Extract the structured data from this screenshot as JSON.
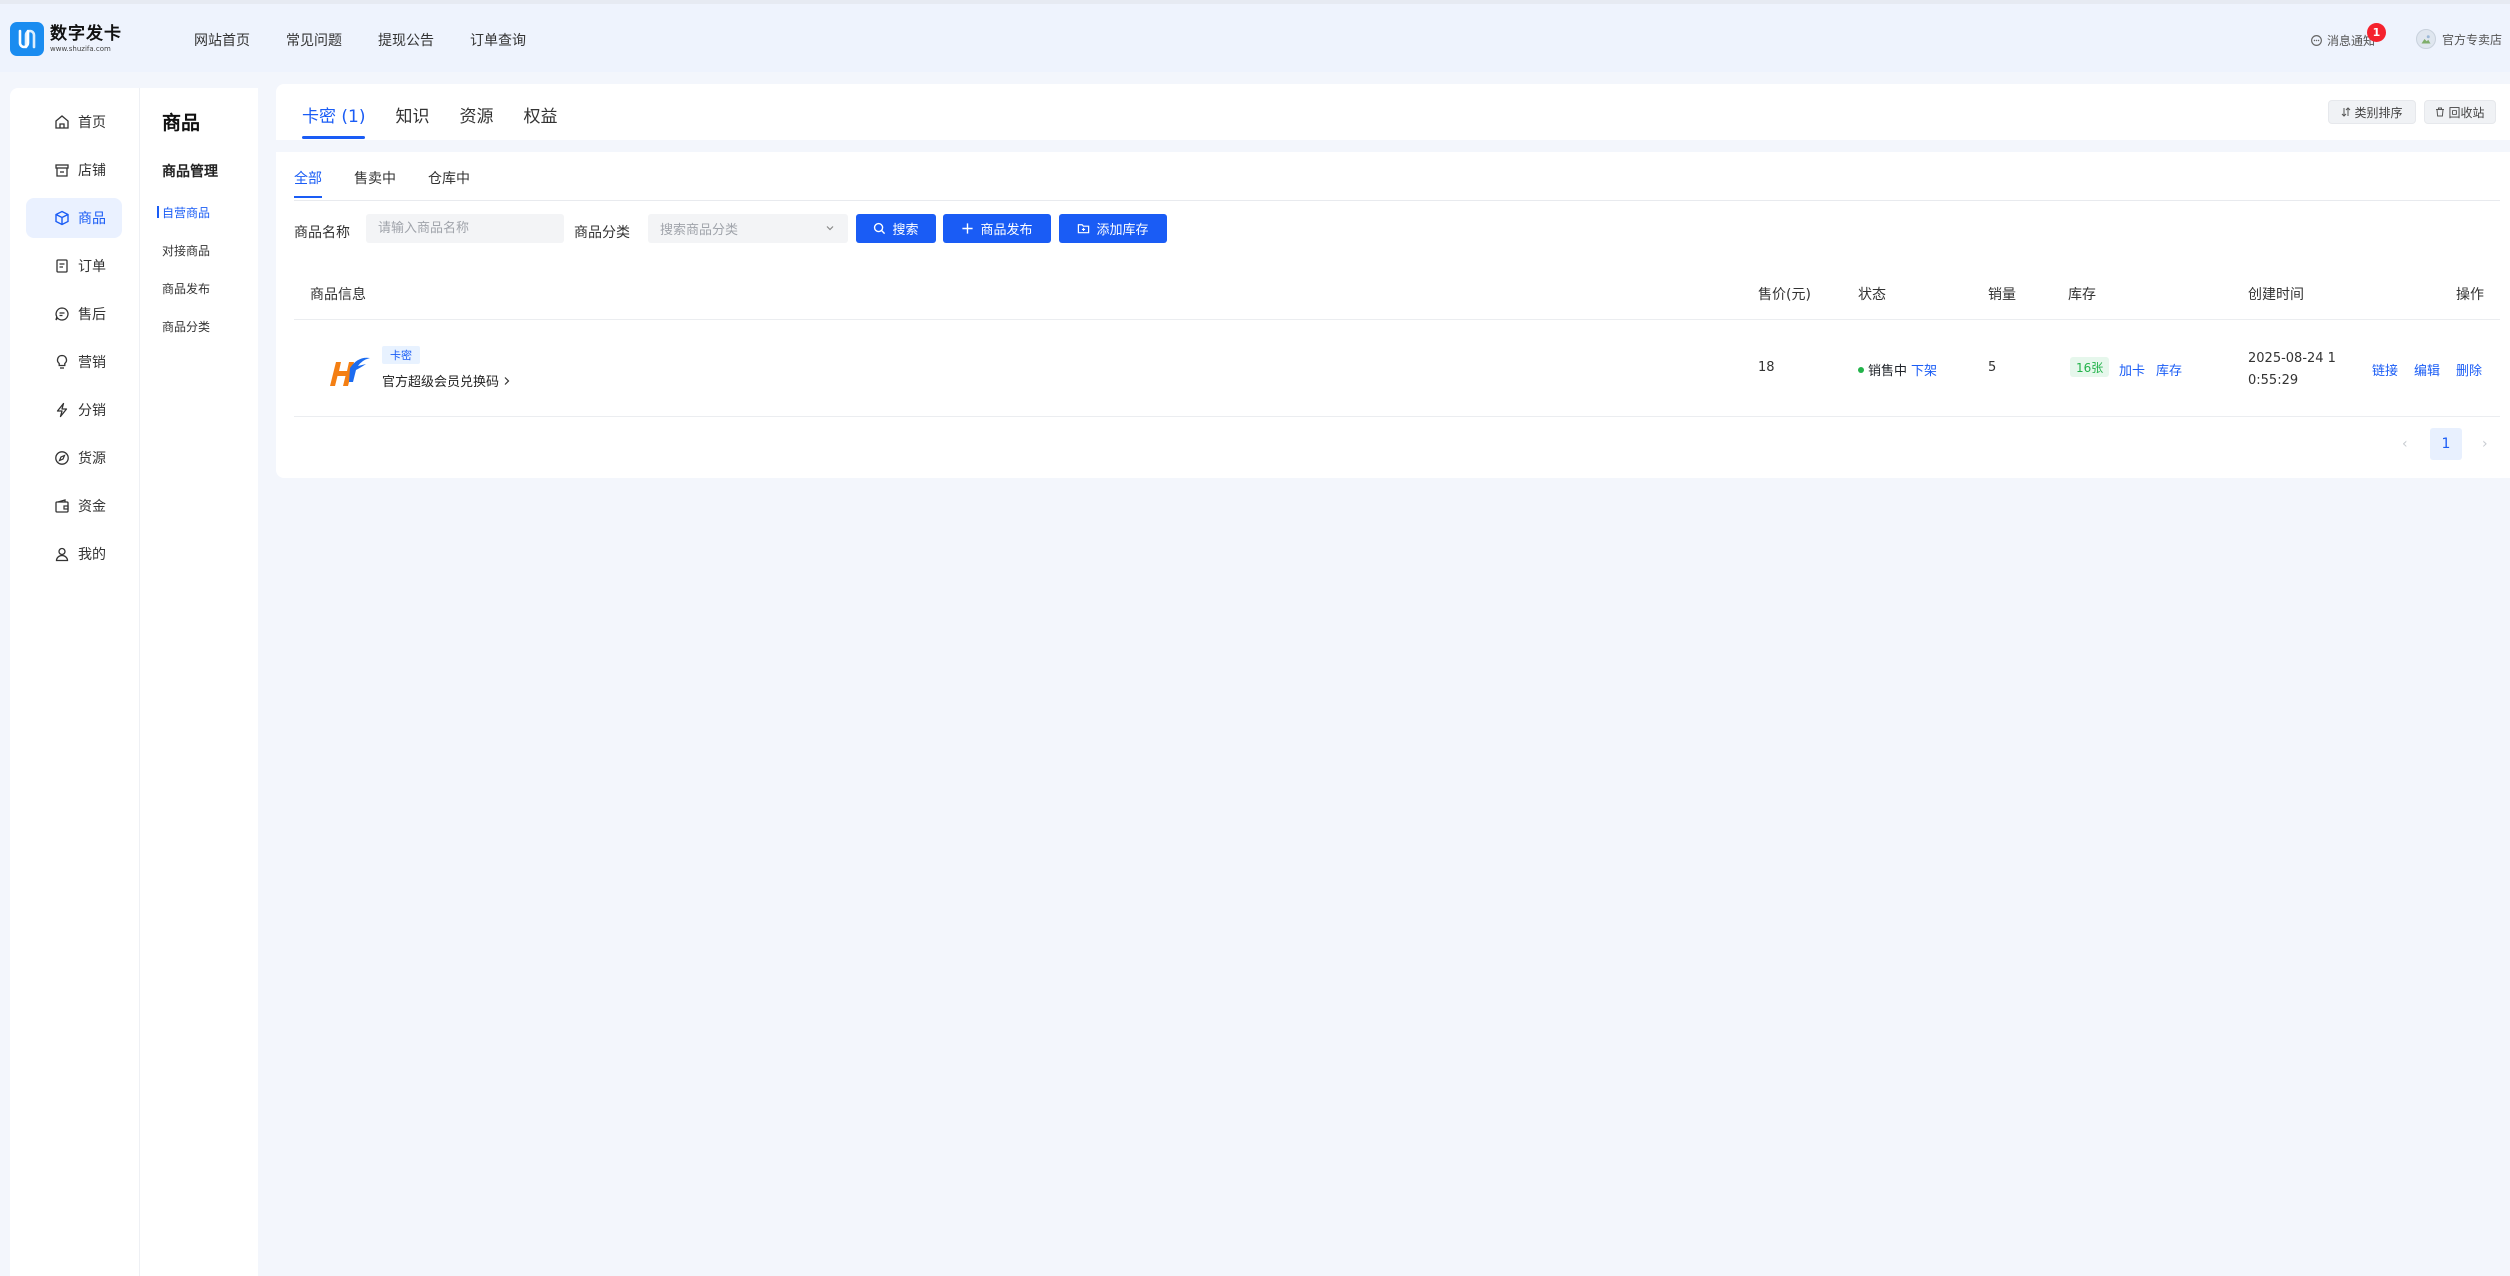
{
  "brand": {
    "name": "数字发卡",
    "url": "www.shuzifa.com",
    "accent": "#1a5cf5"
  },
  "topnav": [
    "网站首页",
    "常见问题",
    "提现公告",
    "订单查询"
  ],
  "header": {
    "messages_label": "消息通知",
    "messages_badge": "1",
    "user_name": "官方专卖店"
  },
  "sidebar": {
    "items": [
      {
        "label": "首页",
        "icon": "home-icon"
      },
      {
        "label": "店铺",
        "icon": "store-icon"
      },
      {
        "label": "商品",
        "icon": "box-icon",
        "active": true
      },
      {
        "label": "订单",
        "icon": "order-icon"
      },
      {
        "label": "售后",
        "icon": "chat-icon"
      },
      {
        "label": "营销",
        "icon": "bulb-icon"
      },
      {
        "label": "分销",
        "icon": "bolt-icon"
      },
      {
        "label": "货源",
        "icon": "compass-icon"
      },
      {
        "label": "资金",
        "icon": "wallet-icon"
      },
      {
        "label": "我的",
        "icon": "user-icon"
      }
    ]
  },
  "subnav": {
    "title": "商品",
    "group": "商品管理",
    "items": [
      "自营商品",
      "对接商品",
      "商品发布",
      "商品分类"
    ]
  },
  "main": {
    "tabs": [
      "卡密 (1)",
      "知识",
      "资源",
      "权益"
    ],
    "sort_button": "类别排序",
    "recycle_button": "回收站",
    "sub_tabs": [
      "全部",
      "售卖中",
      "仓库中"
    ],
    "filter": {
      "name_label": "商品名称",
      "name_placeholder": "请输入商品名称",
      "category_label": "商品分类",
      "category_placeholder": "搜索商品分类",
      "search_button": "搜索",
      "publish_button": "商品发布",
      "add_stock_button": "添加库存"
    },
    "table": {
      "headers": [
        "商品信息",
        "售价(元)",
        "状态",
        "销量",
        "库存",
        "创建时间",
        "操作"
      ],
      "rows": [
        {
          "tag": "卡密",
          "name": "官方超级会员兑换码",
          "price": "18",
          "status": "销售中",
          "status_action": "下架",
          "sales": "5",
          "stock": "16张",
          "stock_add": "加卡",
          "stock_view": "库存",
          "created": "2025-08-24 10:55:29",
          "actions": [
            "链接",
            "编辑",
            "删除"
          ]
        }
      ]
    },
    "pagination": {
      "current": "1"
    }
  }
}
